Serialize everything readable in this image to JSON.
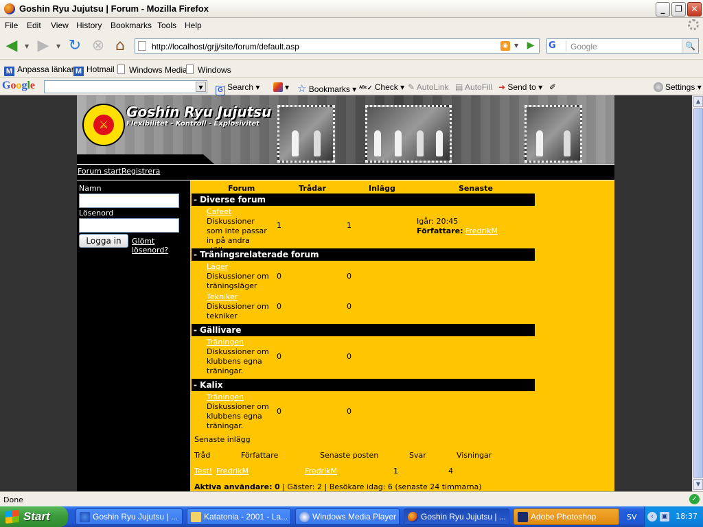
{
  "window": {
    "title": "Goshin Ryu Jujutsu | Forum - Mozilla Firefox",
    "minimize": "_",
    "maximize": "❐",
    "close": "✕"
  },
  "menu": [
    "File",
    "Edit",
    "View",
    "History",
    "Bookmarks",
    "Tools",
    "Help"
  ],
  "nav": {
    "url": "http://localhost/grjj/site/forum/default.asp",
    "search_placeholder": "Google",
    "search_engine": "G"
  },
  "bookmarks": [
    "Anpassa länkar",
    "Hotmail",
    "Windows Media",
    "Windows"
  ],
  "google_toolbar": {
    "logo": "Google",
    "search": "Search",
    "bookmarks": "Bookmarks",
    "check": "Check",
    "autolink": "AutoLink",
    "autofill": "AutoFill",
    "sendto": "Send to",
    "settings": "Settings"
  },
  "site": {
    "title": "Goshin Ryu Jujutsu",
    "subtitle": "Flexibilitet - Kontroll - Explosivitet",
    "nav": [
      "Forum start",
      "Registrera"
    ]
  },
  "login": {
    "name_label": "Namn",
    "password_label": "Lösenord",
    "button": "Logga in",
    "forgot": "Glömt lösenord?"
  },
  "forum": {
    "headers": [
      "Forum",
      "Trådar",
      "Inlägg",
      "Senaste"
    ],
    "categories": [
      {
        "title": "- Diverse forum",
        "forums": [
          {
            "name": "Cafeet",
            "desc": "Diskussioner som inte passar in på andra ställen.",
            "threads": "1",
            "posts": "1",
            "latest_time": "Igår: 20:45",
            "author_label": "Författare:",
            "author": "FredrikM"
          }
        ]
      },
      {
        "title": "- Träningsrelaterade forum",
        "forums": [
          {
            "name": "Läger",
            "desc": "Diskussioner om träningsläger",
            "threads": "0",
            "posts": "0"
          },
          {
            "name": "Tekniker",
            "desc": "Diskussioner om tekniker",
            "threads": "0",
            "posts": "0"
          }
        ]
      },
      {
        "title": "- Gällivare",
        "forums": [
          {
            "name": "Träningen",
            "desc": "Diskussioner om klubbens egna träningar.",
            "threads": "0",
            "posts": "0"
          }
        ]
      },
      {
        "title": "- Kalix",
        "forums": [
          {
            "name": "Träningen",
            "desc": "Diskussioner om klubbens egna träningar.",
            "threads": "0",
            "posts": "0"
          }
        ]
      }
    ],
    "recent": {
      "title": "Senaste inlägg",
      "headers": [
        "Tråd",
        "Författare",
        "Senaste posten",
        "Svar",
        "Visningar"
      ],
      "rows": [
        {
          "thread": "Test!",
          "author": "FredrikM",
          "last": "FredrikM",
          "replies": "1",
          "views": "4"
        }
      ]
    },
    "stats": {
      "active_label": "Aktiva användare:",
      "active_count": "0",
      "rest": "| Gäster: 2 | Besökare idag: 6 (senaste 24 timmarna)"
    }
  },
  "status": "Done",
  "taskbar": {
    "start": "Start",
    "tasks": [
      "Goshin Ryu Jujutsu | ...",
      "Katatonia - 2001 - La...",
      "Windows Media Player",
      "Goshin Ryu Jujutsu | ...",
      "Adobe Photoshop"
    ],
    "lang": "SV",
    "clock": "18:37"
  },
  "colors": {
    "forum_bg": "#ffc600",
    "category_bg": "#000000",
    "page_bg": "#333333"
  }
}
